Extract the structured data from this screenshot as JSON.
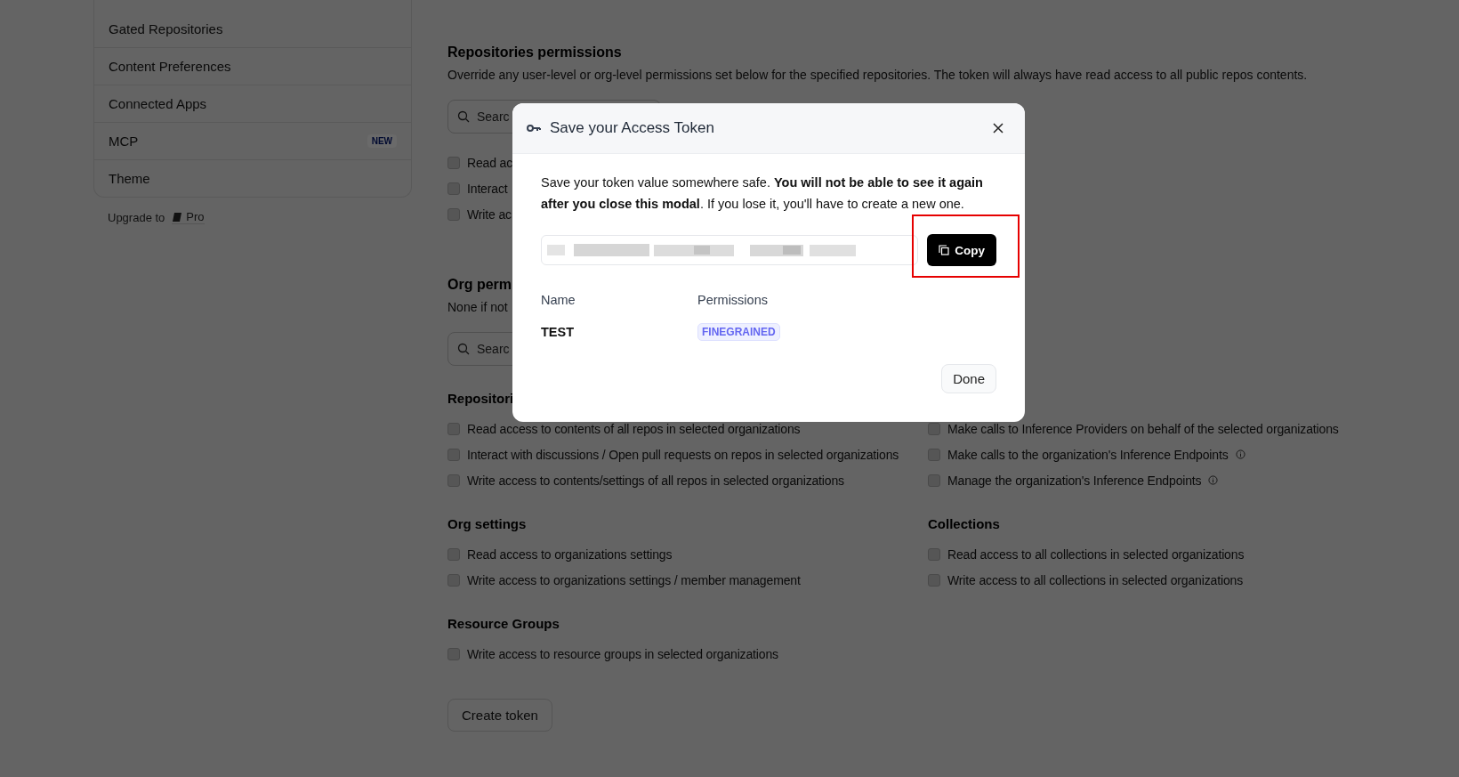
{
  "sidebar": {
    "items": [
      {
        "label": "Gated Repositories"
      },
      {
        "label": "Content Preferences"
      },
      {
        "label": "Connected Apps"
      },
      {
        "label": "MCP",
        "badge": "NEW"
      },
      {
        "label": "Theme"
      }
    ],
    "upgrade": {
      "label": "Upgrade to",
      "plan": "Pro"
    }
  },
  "repo_permissions": {
    "title": "Repositories permissions",
    "description": "Override any user-level or org-level permissions set below for the specified repositories. The token will always have read access to all public repos contents.",
    "search_placeholder": "Searc",
    "options": [
      {
        "label": "Read ac",
        "checked": false
      },
      {
        "label": "Interact",
        "checked": false
      },
      {
        "label": "Write ac",
        "checked": false
      }
    ]
  },
  "org_permissions": {
    "title": "Org perm",
    "description": "None if not",
    "search_placeholder": "Searc",
    "sections": [
      {
        "columns": [
          {
            "title": "Repositori",
            "options": [
              {
                "label": "Read access to contents of all repos in selected organizations",
                "checked": false,
                "info": false
              },
              {
                "label": "Interact with discussions / Open pull requests on repos in selected organizations",
                "checked": false,
                "info": false
              },
              {
                "label": "Write access to contents/settings of all repos in selected organizations",
                "checked": false,
                "info": false
              }
            ]
          },
          {
            "options": [
              {
                "label": "Make calls to Inference Providers on behalf of the selected organizations",
                "checked": false,
                "info": false
              },
              {
                "label": "Make calls to the organization's Inference Endpoints",
                "checked": false,
                "info": true
              },
              {
                "label": "Manage the organization's Inference Endpoints",
                "checked": false,
                "info": true
              }
            ]
          }
        ]
      },
      {
        "columns": [
          {
            "title": "Org settings",
            "options": [
              {
                "label": "Read access to organizations settings",
                "checked": false,
                "info": false
              },
              {
                "label": "Write access to organizations settings / member management",
                "checked": false,
                "info": false
              }
            ]
          },
          {
            "title": "Collections",
            "options": [
              {
                "label": "Read access to all collections in selected organizations",
                "checked": false,
                "info": false
              },
              {
                "label": "Write access to all collections in selected organizations",
                "checked": false,
                "info": false
              }
            ]
          }
        ]
      },
      {
        "columns": [
          {
            "title": "Resource Groups",
            "options": [
              {
                "label": "Write access to resource groups in selected organizations",
                "checked": false,
                "info": false
              }
            ]
          }
        ]
      }
    ]
  },
  "create_button": "Create token",
  "modal": {
    "title": "Save your Access Token",
    "message": "Save your token value somewhere safe. **You will not be able to see it again after you close this modal**. If you lose it, you'll have to create a new one.",
    "copy_button": {
      "label": "Copy",
      "highlighted": true
    },
    "columns": [
      "Name",
      "Permissions"
    ],
    "token": {
      "name": "TEST",
      "permission": "FINEGRAINED"
    },
    "done_button": "Done"
  }
}
